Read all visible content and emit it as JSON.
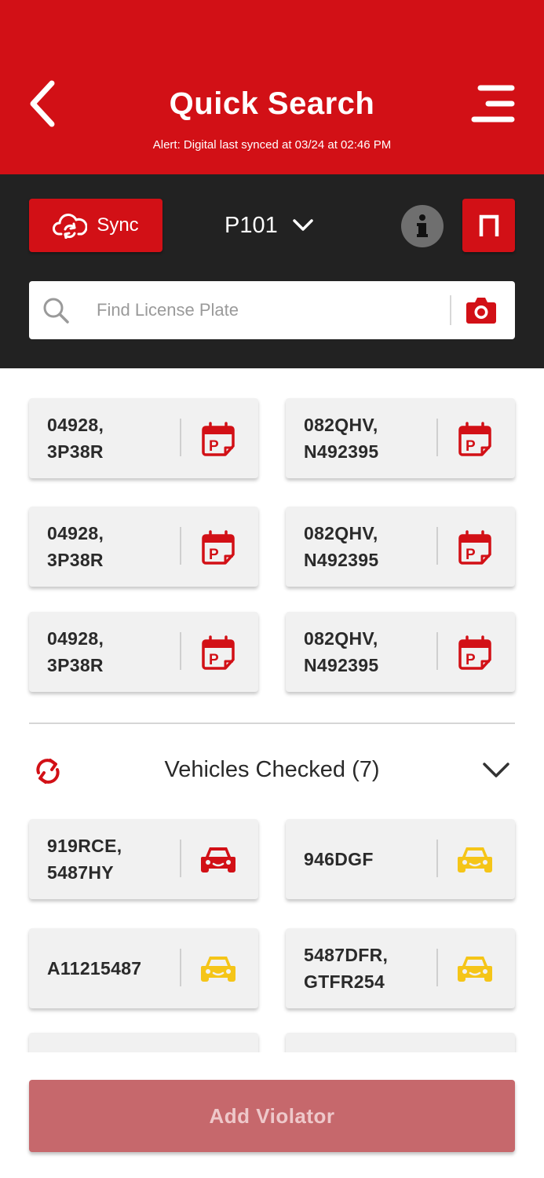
{
  "header": {
    "title": "Quick Search",
    "alert": "Alert: Digital last synced at 03/24 at 02:46 PM"
  },
  "toolbar": {
    "sync_label": "Sync",
    "zone": "P101"
  },
  "search": {
    "placeholder": "Find License Plate"
  },
  "plates": [
    {
      "text": "04928,\n3P38R",
      "icon": "parking-calendar-icon"
    },
    {
      "text": "082QHV,\nN492395",
      "icon": "parking-calendar-icon"
    },
    {
      "text": "04928,\n3P38R",
      "icon": "parking-calendar-icon"
    },
    {
      "text": "082QHV,\nN492395",
      "icon": "parking-calendar-icon"
    },
    {
      "text": "04928,\n3P38R",
      "icon": "parking-calendar-icon"
    },
    {
      "text": "082QHV,\nN492395",
      "icon": "parking-calendar-icon"
    }
  ],
  "vehicles_checked": {
    "label": "Vehicles Checked (7)",
    "items": [
      {
        "text": "919RCE,\n5487HY",
        "icon": "car-icon",
        "status_color": "#d21016"
      },
      {
        "text": "946DGF",
        "icon": "car-icon",
        "status_color": "#f5c518"
      },
      {
        "text": "A11215487",
        "icon": "car-icon",
        "status_color": "#f5c518"
      },
      {
        "text": "5487DFR,\nGTFR254",
        "icon": "car-icon",
        "status_color": "#f5c518"
      }
    ]
  },
  "footer": {
    "add_label": "Add Violator"
  },
  "colors": {
    "brand_red": "#d21016",
    "toolbar_dark": "#222222",
    "disabled_button": "#c6686c"
  }
}
